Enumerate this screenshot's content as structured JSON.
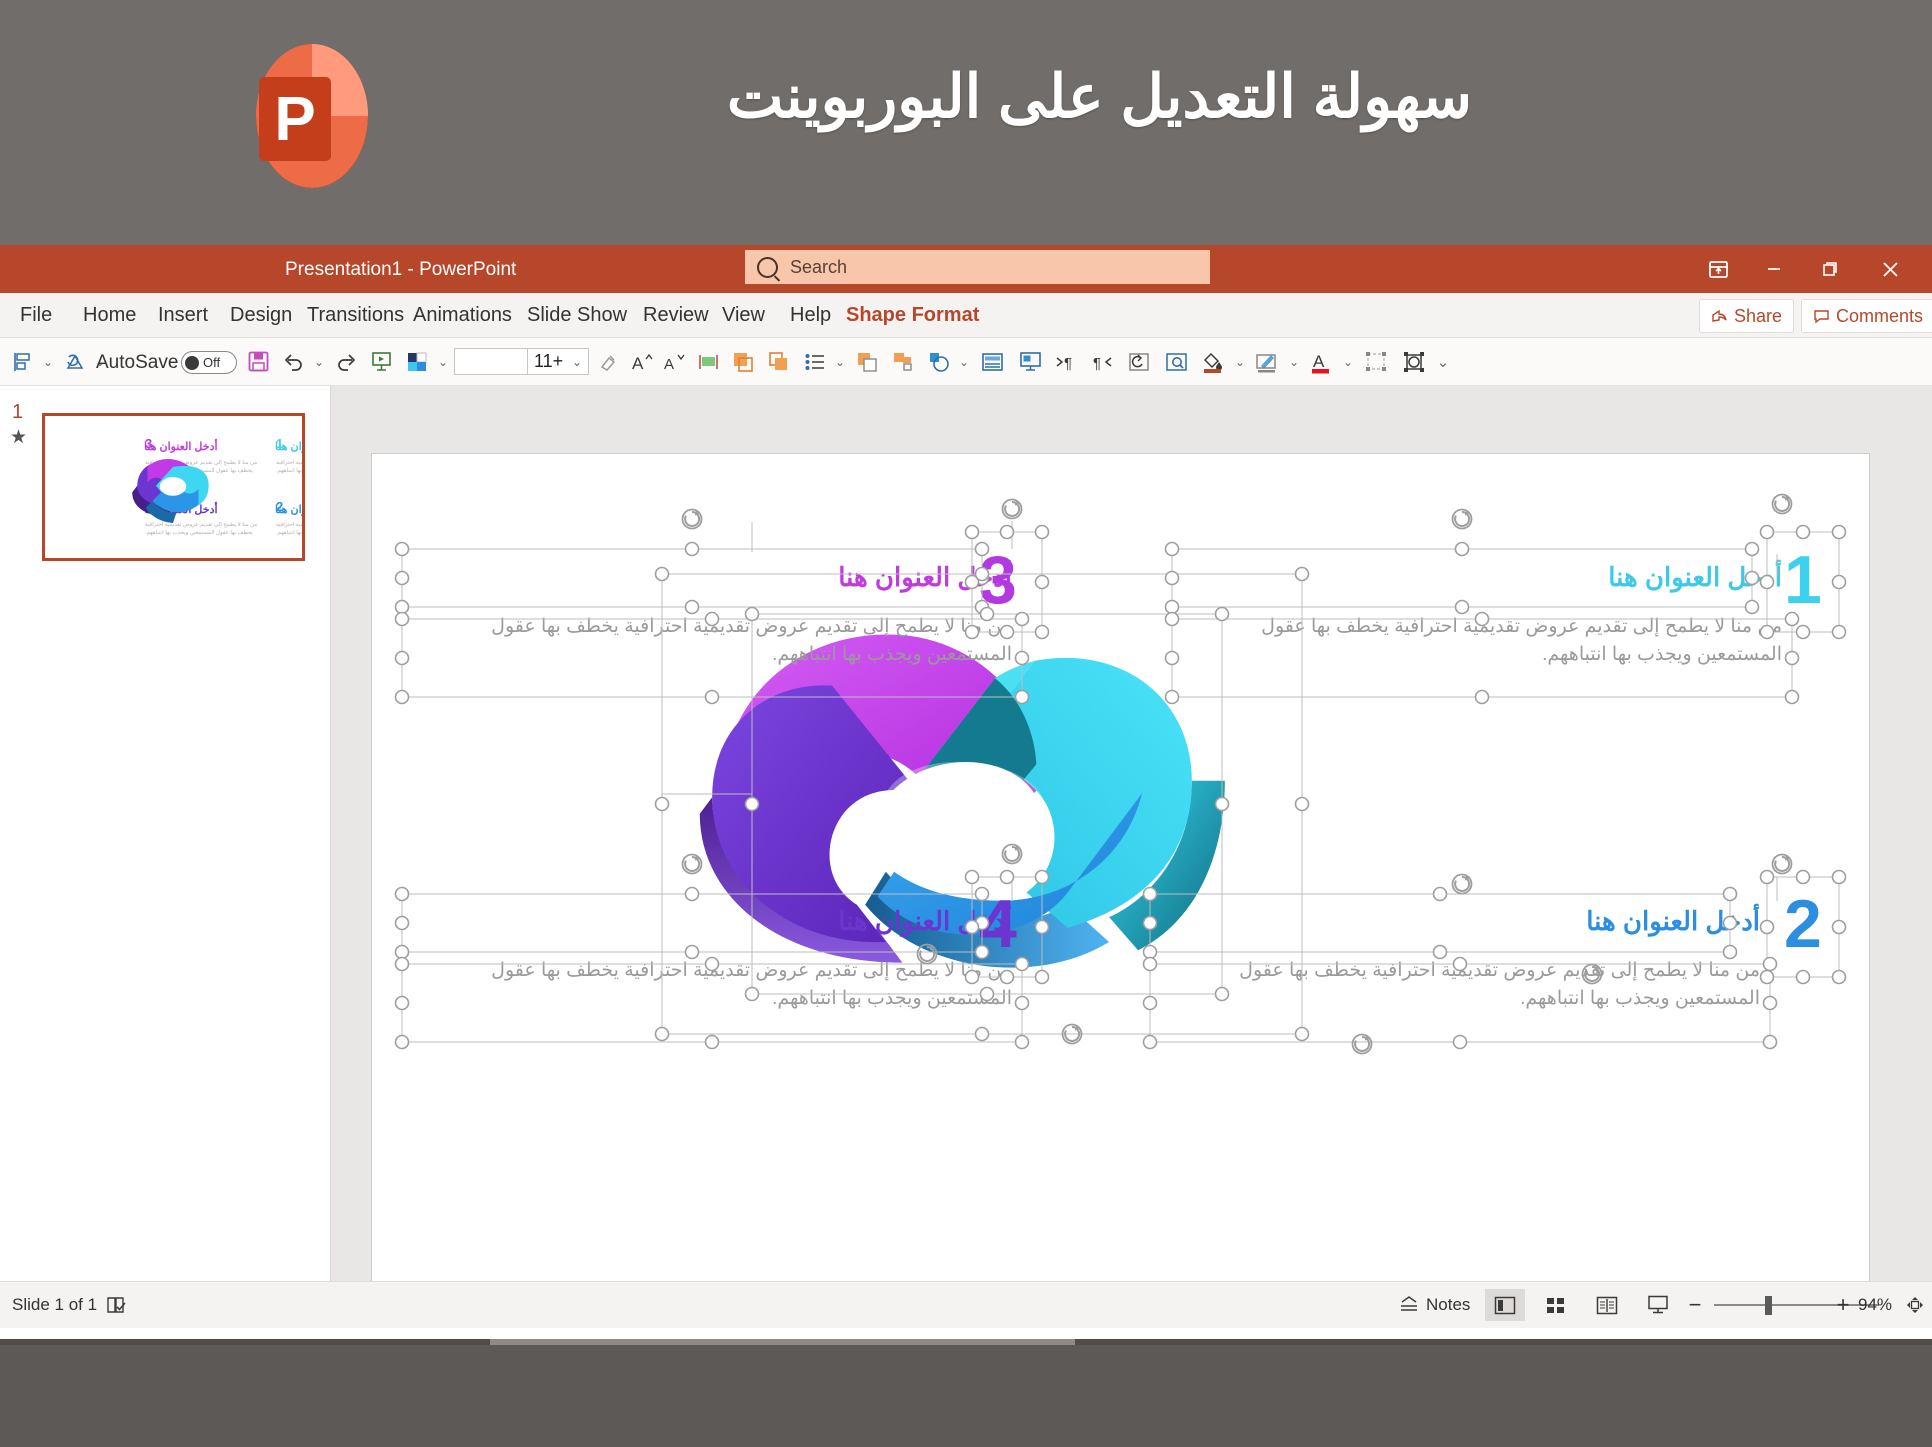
{
  "promo": {
    "title": "سهولة التعديل على البوربوينت",
    "logo_letter": "P",
    "logo_colors": {
      "dark": "#c43e1c",
      "light": "#ed6c47",
      "pale": "#ff8f6b"
    },
    "bg": "#716d6a"
  },
  "titlebar": {
    "document_title": "Presentation1  -  PowerPoint",
    "search_placeholder": "Search",
    "search_value": "",
    "bg": "#b7472a",
    "buttons": [
      {
        "name": "ribbon-display-options",
        "glyph": "⬒"
      },
      {
        "name": "minimize",
        "glyph": "–"
      },
      {
        "name": "restore",
        "glyph": "❐"
      },
      {
        "name": "close",
        "glyph": "✕"
      }
    ]
  },
  "ribbon": {
    "tabs": [
      {
        "label": "File",
        "active": false
      },
      {
        "label": "Home",
        "active": false
      },
      {
        "label": "Insert",
        "active": false
      },
      {
        "label": "Design",
        "active": false
      },
      {
        "label": "Transitions",
        "active": false
      },
      {
        "label": "Animations",
        "active": false
      },
      {
        "label": "Slide Show",
        "active": false
      },
      {
        "label": "Review",
        "active": false
      },
      {
        "label": "View",
        "active": false
      },
      {
        "label": "Help",
        "active": false
      },
      {
        "label": "Shape Format",
        "active": true
      }
    ],
    "accent_color": "#b7472a",
    "share_label": "Share",
    "comments_label": "Comments"
  },
  "toolbar": {
    "autosave_label": "AutoSave",
    "autosave_state": "Off",
    "font_name": "",
    "font_size": "11+",
    "items": [
      {
        "name": "align-objects-icon"
      },
      {
        "name": "repeat-action-icon"
      },
      {
        "name": "save-icon"
      },
      {
        "name": "undo-icon"
      },
      {
        "name": "redo-icon"
      },
      {
        "name": "start-slideshow-icon"
      },
      {
        "name": "theme-colors-icon"
      },
      {
        "name": "format-painter-icon"
      },
      {
        "name": "increase-font-size-icon"
      },
      {
        "name": "decrease-font-size-icon"
      },
      {
        "name": "text-direction-icon"
      },
      {
        "name": "shape-fill-orange-icon"
      },
      {
        "name": "duplicate-shape-icon"
      },
      {
        "name": "bullets-icon"
      },
      {
        "name": "bring-forward-icon"
      },
      {
        "name": "group-objects-icon"
      },
      {
        "name": "shape-merge-icon"
      },
      {
        "name": "layout-icon"
      },
      {
        "name": "slide-show-from-current-icon"
      },
      {
        "name": "increase-indent-rtl-icon"
      },
      {
        "name": "decrease-indent-rtl-icon"
      },
      {
        "name": "reset-slide-icon"
      },
      {
        "name": "zoom-preview-icon"
      },
      {
        "name": "shape-fill-icon"
      },
      {
        "name": "shape-outline-icon"
      },
      {
        "name": "font-color-icon"
      },
      {
        "name": "arrange-icon"
      },
      {
        "name": "selection-pane-icon"
      },
      {
        "name": "more-commands-icon"
      }
    ]
  },
  "thumbnails": {
    "slide_number": "1",
    "animation_marker": "★"
  },
  "slide": {
    "blocks": [
      {
        "id": "block-1",
        "number": "1",
        "number_color": "#3ed0ef",
        "title": "أدخل العنوان هنا",
        "title_color": "#3ec9e8",
        "body": "من منا لا يطمح إلى تقديم عروض تقديمية احترافية يخطف بها عقول المستمعين ويجذب بها انتباههم."
      },
      {
        "id": "block-2",
        "number": "2",
        "number_color": "#2b8ee0",
        "title": "أدخل العنوان هنا",
        "title_color": "#2b8ee0",
        "body": "من منا لا يطمح إلى تقديم عروض تقديمية احترافية يخطف بها عقول المستمعين ويجذب بها انتباههم."
      },
      {
        "id": "block-3",
        "number": "3",
        "number_color": "#b239e0",
        "title": "أدخل العنوان هنا",
        "title_color": "#c13ae0",
        "body": "من منا لا يطمح إلى تقديم عروض تقديمية احترافية يخطف بها عقول المستمعين ويجذب بها انتباههم."
      },
      {
        "id": "block-4",
        "number": "4",
        "number_color": "#6b35cf",
        "title": "أدخل العنوان هنا",
        "title_color": "#6b35cf",
        "body": "من منا لا يطمح إلى تقديم عروض تقديمية احترافية يخطف بها عقول المستمعين ويجذب بها انتباههم."
      }
    ],
    "graphic": {
      "name": "3d-cycle-infinity-diagram",
      "segments": [
        {
          "name": "magenta-segment",
          "top": "#c23ae8",
          "side": "#8e2ba8"
        },
        {
          "name": "cyan-segment",
          "top": "#3ed6f0",
          "side": "#1b7f95"
        },
        {
          "name": "blue-segment",
          "top": "#2b96e8",
          "side": "#1b6aa8"
        },
        {
          "name": "purple-segment",
          "top": "#6b35cf",
          "side": "#46208a"
        }
      ]
    }
  },
  "status": {
    "slide_counter": "Slide 1 of 1",
    "accessibility_icon": "accessibility-checker-icon",
    "notes_label": "Notes",
    "views": [
      {
        "name": "normal-view",
        "active": true
      },
      {
        "name": "slide-sorter-view",
        "active": false
      },
      {
        "name": "reading-view",
        "active": false
      },
      {
        "name": "slideshow-view",
        "active": false
      }
    ],
    "zoom_out": "−",
    "zoom_in": "+",
    "zoom_level": "94%",
    "fit_slide_icon": "fit-slide-to-window-icon"
  }
}
